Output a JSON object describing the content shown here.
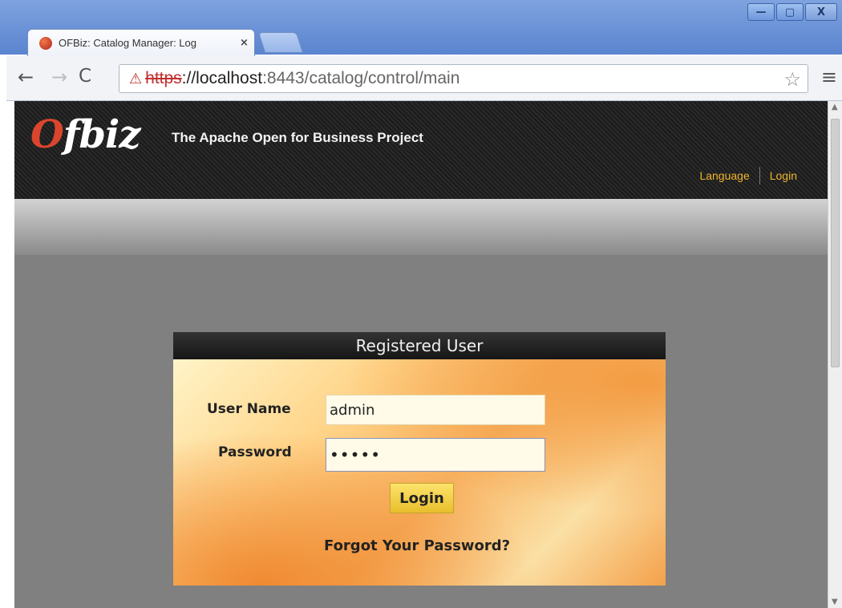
{
  "browser": {
    "tab_title": "OFBiz: Catalog Manager: Log",
    "tab_close": "×",
    "window_controls": {
      "minimize": "—",
      "maximize": "▢",
      "close": "X"
    },
    "nav": {
      "back": "←",
      "forward": "→",
      "reload": "C"
    },
    "url": {
      "scheme": "https",
      "host": "://localhost",
      "port_path": ":8443/catalog/control/main"
    },
    "icons": {
      "lock": "lock-warning-icon",
      "star": "star-icon",
      "menu": "menu-icon"
    }
  },
  "header": {
    "logo": "Ofbiz",
    "tagline": "The Apache Open for Business Project",
    "links": [
      "Language",
      "Login"
    ]
  },
  "login": {
    "title": "Registered User",
    "username_label": "User Name",
    "username_value": "admin",
    "password_label": "Password",
    "password_value": "•••••",
    "submit_label": "Login",
    "forgot_link": "Forgot Your Password?"
  },
  "colors": {
    "header_link": "#f0b52c",
    "page_background": "#808080",
    "logo_accent": "#d9462d"
  }
}
